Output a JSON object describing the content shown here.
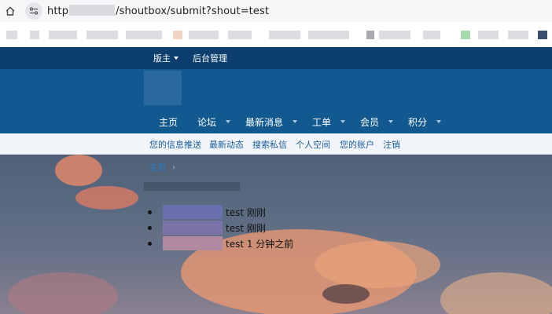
{
  "browser": {
    "url_prefix": "http",
    "url_suffix": "/shoutbox/submit?shout=test"
  },
  "top_strip": {
    "moderator_label": "版主",
    "admin_label": "后台管理"
  },
  "main_nav": {
    "items": [
      {
        "label": "主页"
      },
      {
        "label": "论坛"
      },
      {
        "label": "最新消息"
      },
      {
        "label": "工单"
      },
      {
        "label": "会员"
      },
      {
        "label": "积分"
      }
    ]
  },
  "sub_nav": {
    "items": [
      {
        "label": "您的信息推送"
      },
      {
        "label": "最新动态"
      },
      {
        "label": "搜索私信"
      },
      {
        "label": "个人空间"
      },
      {
        "label": "您的账户"
      },
      {
        "label": "注销"
      }
    ]
  },
  "breadcrumb": {
    "home": "主页",
    "separator": "›"
  },
  "shouts": [
    {
      "text": "test 刚刚"
    },
    {
      "text": "test 刚刚"
    },
    {
      "text": "test 1 分钟之前"
    }
  ],
  "colors": {
    "header_dark": "#0c3f6e",
    "banner": "#11598f",
    "link": "#1a5a9a"
  }
}
